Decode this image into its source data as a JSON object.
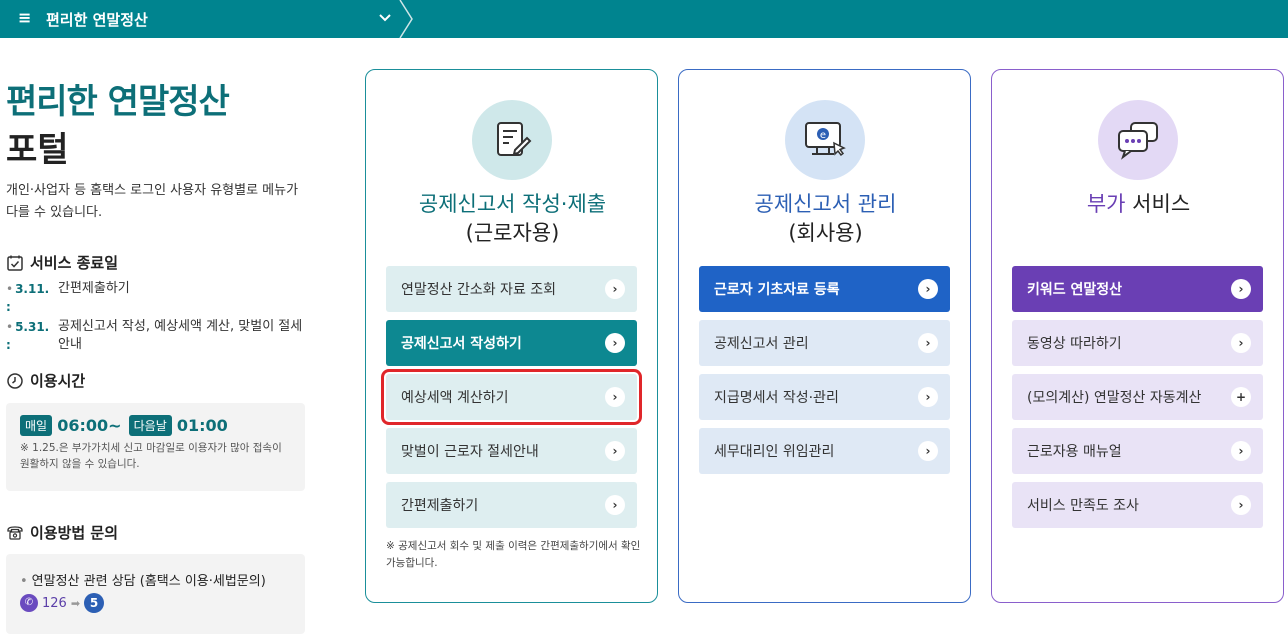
{
  "topbar": {
    "menu_icon": "≡",
    "title": "편리한 연말정산",
    "chevron": "⌄"
  },
  "left": {
    "title_line1": "편리한 연말정산",
    "title_line2": "포털",
    "description": "개인·사업자 등 홈택스 로그인 사용자 유형별로 메뉴가 다를 수 있습니다.",
    "end_dates": {
      "heading": "서비스 종료일",
      "items": [
        {
          "date": "3.11. :",
          "text": "간편제출하기"
        },
        {
          "date": "5.31. :",
          "text": "공제신고서 작성, 예상세액 계산, 맞벌이 절세 안내"
        }
      ]
    },
    "hours": {
      "heading": "이용시간",
      "badge_start": "매일",
      "start_time": "06:00~",
      "badge_end": "다음날",
      "end_time": "01:00",
      "note": "※ 1.25.은 부가가치세 신고 마감일로 이용자가 많아 접속이 원활하지 않을 수 있습니다."
    },
    "contact": {
      "heading": "이용방법 문의",
      "line": "연말정산 관련 상담 (홈택스 이용·세법문의)",
      "phone": "126",
      "option": "5"
    }
  },
  "cards": [
    {
      "title_hl": "공제신고서 작성·제출",
      "title_sub": "(근로자용)",
      "buttons": [
        {
          "label": "연말정산 간소화 자료 조회",
          "icon": "›"
        },
        {
          "label": "공제신고서 작성하기",
          "icon": "›"
        },
        {
          "label": "예상세액 계산하기",
          "icon": "›"
        },
        {
          "label": "맞벌이 근로자 절세안내",
          "icon": "›"
        },
        {
          "label": "간편제출하기",
          "icon": "›"
        }
      ],
      "note": "※ 공제신고서 회수 및 제출 이력은 간편제출하기에서 확인 가능합니다."
    },
    {
      "title_hl": "공제신고서 관리",
      "title_sub": "(회사용)",
      "buttons": [
        {
          "label": "근로자 기초자료 등록",
          "icon": "›"
        },
        {
          "label": "공제신고서 관리",
          "icon": "›"
        },
        {
          "label": "지급명세서 작성·관리",
          "icon": "›"
        },
        {
          "label": "세무대리인 위임관리",
          "icon": "›"
        }
      ]
    },
    {
      "title_hl": "부가",
      "title_rest": " 서비스",
      "buttons": [
        {
          "label": "키워드 연말정산",
          "icon": "›"
        },
        {
          "label": "동영상 따라하기",
          "icon": "›"
        },
        {
          "label": "(모의계산) 연말정산 자동계산",
          "icon": "+"
        },
        {
          "label": "근로자용 매뉴얼",
          "icon": "›"
        },
        {
          "label": "서비스 만족도 조사",
          "icon": "›"
        }
      ]
    }
  ]
}
